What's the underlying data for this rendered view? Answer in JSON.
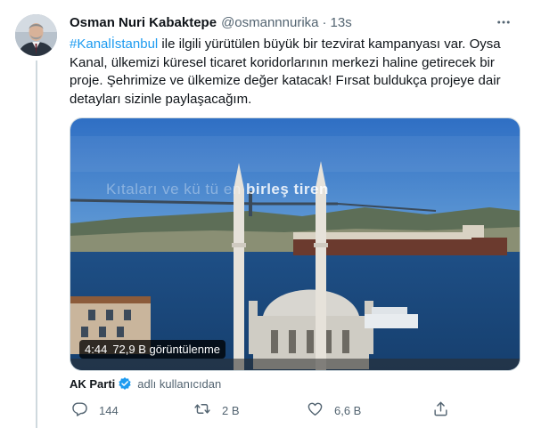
{
  "tweet": {
    "author_name": "Osman Nuri Kabaktepe",
    "handle": "@osmannnurika",
    "separator": "·",
    "time": "13s",
    "hashtag": "#Kanalİstanbul",
    "body": " ile ilgili yürütülen büyük bir tezvirat kampanyası var. Oysa Kanal, ülkemizi küresel ticaret koridorlarının merkezi haline getirecek bir proje. Şehrimize ve ülkemize değer katacak! Fırsat buldukça projeye dair detayları sizinle paylaşacağım."
  },
  "video": {
    "duration": "4:44",
    "views": "72,9 B görüntülenme",
    "overlay_faint": "Kıtaları ve kü tü  en ",
    "overlay_bold": "birleş tiren"
  },
  "source": {
    "name": "AK Parti",
    "sub": "adlı kullanıcıdan"
  },
  "actions": {
    "replies": "144",
    "retweets": "2 B",
    "likes": "6,6 B"
  },
  "colors": {
    "accent": "#1d9bf0",
    "text": "#0f1419",
    "muted": "#536471"
  },
  "icons": {
    "more": "more-horizontal-icon",
    "verified": "verified-badge-icon",
    "reply": "reply-icon",
    "retweet": "retweet-icon",
    "like": "like-icon",
    "share": "share-icon"
  }
}
